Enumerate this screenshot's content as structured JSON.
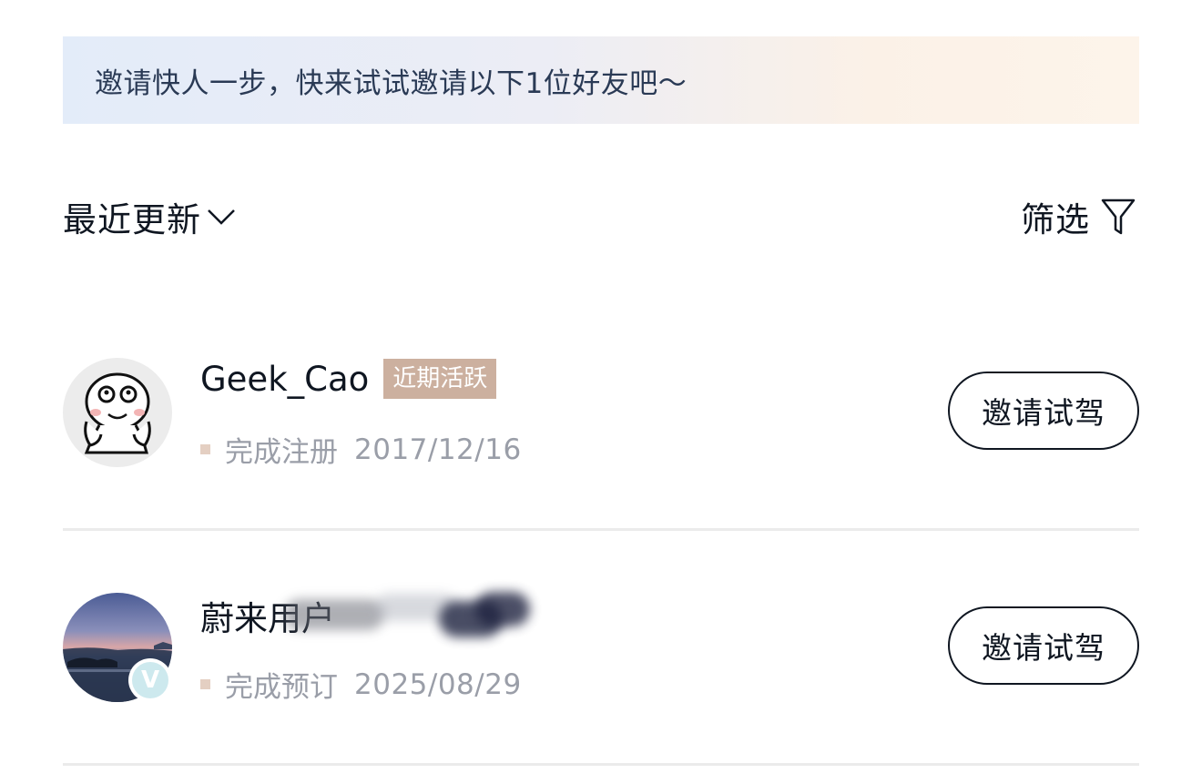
{
  "banner": {
    "text": "邀请快人一步，快来试试邀请以下1位好友吧～"
  },
  "toolbar": {
    "sort_label": "最近更新",
    "filter_label": "筛选"
  },
  "users": [
    {
      "name": "Geek_Cao",
      "tag": "近期活跃",
      "status": "完成注册",
      "date": "2017/12/16",
      "invite_label": "邀请试驾"
    },
    {
      "name": "蔚来用户",
      "status": "完成预订",
      "date": "2025/08/29",
      "invite_label": "邀请试驾",
      "badge": "V"
    }
  ],
  "colors": {
    "tag_bg": "#ccb09f",
    "text_primary": "#0f1621",
    "text_muted": "#9a9ea8",
    "banner_text": "#2a3a55"
  }
}
